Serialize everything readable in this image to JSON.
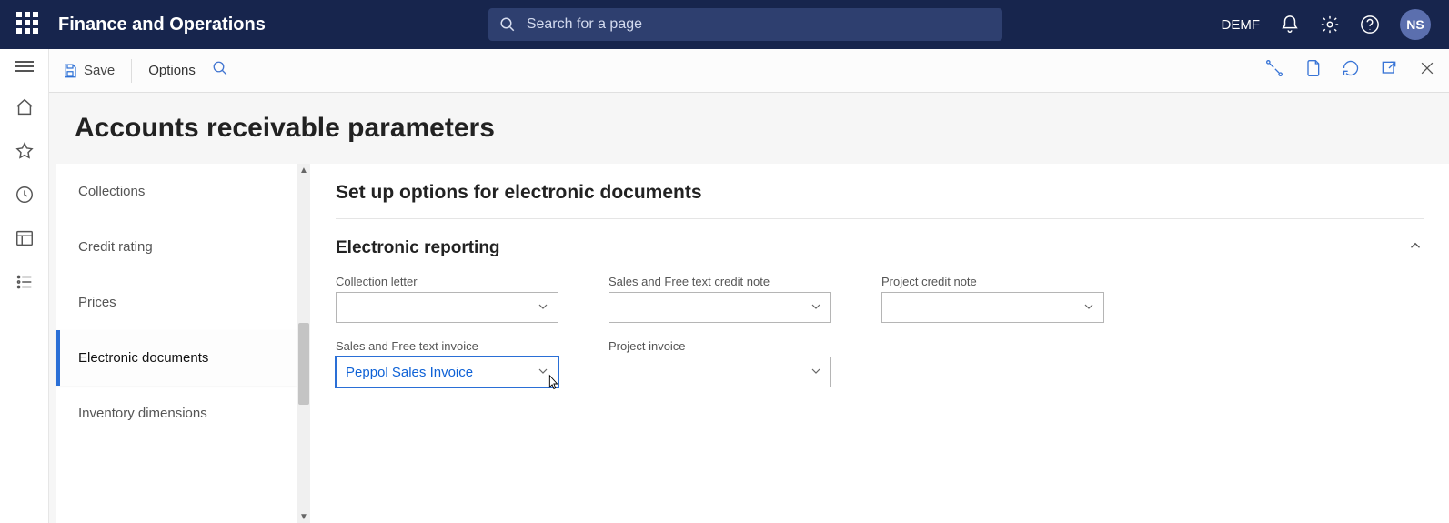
{
  "header": {
    "brand": "Finance and Operations",
    "search_placeholder": "Search for a page",
    "company": "DEMF",
    "avatar_initials": "NS"
  },
  "actionbar": {
    "save_label": "Save",
    "options_label": "Options"
  },
  "page": {
    "title": "Accounts receivable parameters"
  },
  "sidepanel": {
    "items": [
      {
        "label": "Collections",
        "active": false
      },
      {
        "label": "Credit rating",
        "active": false
      },
      {
        "label": "Prices",
        "active": false
      },
      {
        "label": "Electronic documents",
        "active": true
      },
      {
        "label": "Inventory dimensions",
        "active": false
      }
    ]
  },
  "detail": {
    "title": "Set up options for electronic documents",
    "section_title": "Electronic reporting",
    "fields": {
      "collection_letter": {
        "label": "Collection letter",
        "value": ""
      },
      "sales_credit_note": {
        "label": "Sales and Free text credit note",
        "value": ""
      },
      "project_credit_note": {
        "label": "Project credit note",
        "value": ""
      },
      "sales_invoice": {
        "label": "Sales and Free text invoice",
        "value": "Peppol Sales Invoice"
      },
      "project_invoice": {
        "label": "Project invoice",
        "value": ""
      }
    }
  }
}
